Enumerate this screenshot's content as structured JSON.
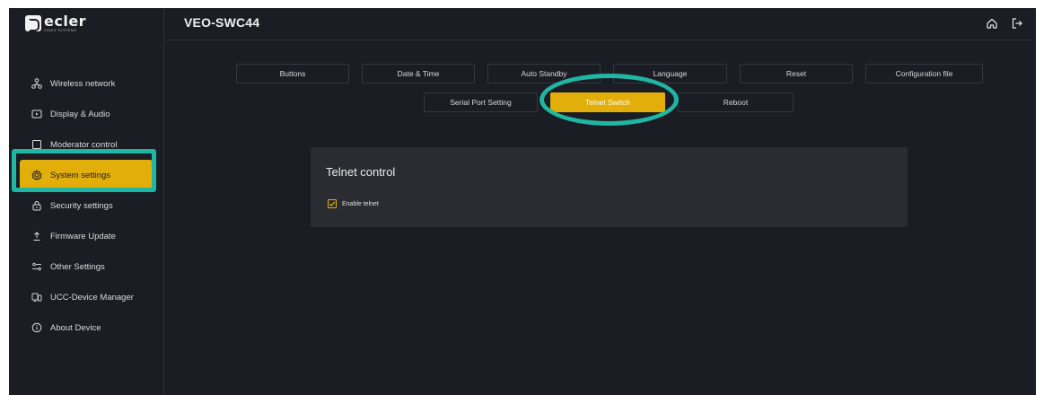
{
  "brand": {
    "name": "ecler",
    "sub": "VIDEO SYSTEMS"
  },
  "header": {
    "device_name": "VEO-SWC44"
  },
  "sidebar": {
    "items": [
      {
        "label": "Wireless network",
        "icon": "network-icon",
        "active": false
      },
      {
        "label": "Display & Audio",
        "icon": "display-icon",
        "active": false
      },
      {
        "label": "Moderator control",
        "icon": "square-icon",
        "active": false
      },
      {
        "label": "System settings",
        "icon": "gear-icon",
        "active": true
      },
      {
        "label": "Security settings",
        "icon": "lock-icon",
        "active": false
      },
      {
        "label": "Firmware Update",
        "icon": "upload-icon",
        "active": false
      },
      {
        "label": "Other Settings",
        "icon": "sliders-icon",
        "active": false
      },
      {
        "label": "UCC-Device Manager",
        "icon": "device-manager-icon",
        "active": false
      },
      {
        "label": "About Device",
        "icon": "info-icon",
        "active": false
      }
    ]
  },
  "tabs": {
    "row1": [
      "Buttons",
      "Date & Time",
      "Auto Standby",
      "Language",
      "Reset",
      "Configuration file"
    ],
    "row2": [
      "Serial Port Setting",
      "Telnet Switch",
      "Reboot"
    ],
    "active": "Telnet Switch"
  },
  "panel": {
    "title": "Telnet control",
    "checkbox_label": "Enable telnet",
    "checkbox_checked": true
  },
  "colors": {
    "accent": "#e2ae09",
    "highlight_ring": "#1fb6a4",
    "background": "#1b1d24",
    "panel": "#2a2c32"
  }
}
